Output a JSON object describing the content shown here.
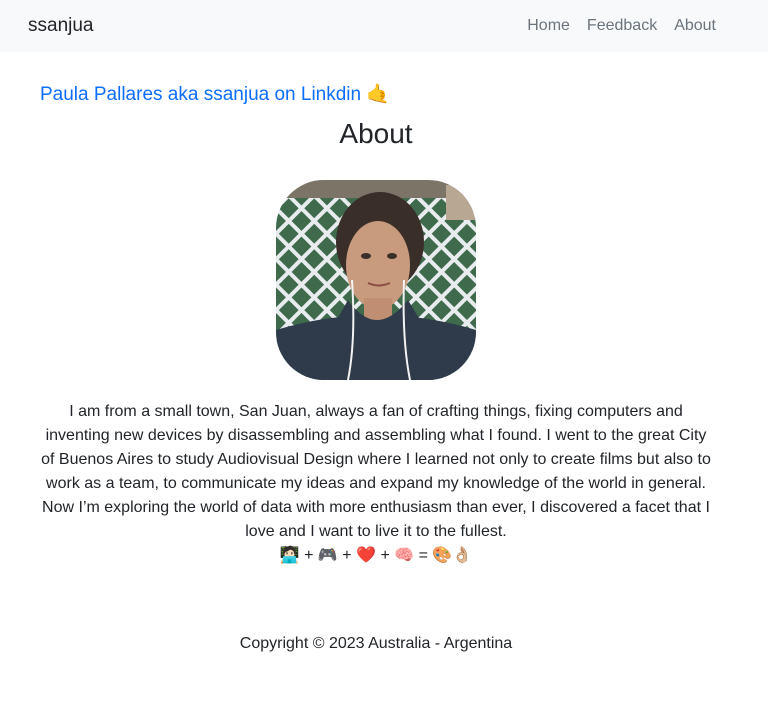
{
  "nav": {
    "brand": "ssanjua",
    "links": [
      "Home",
      "Feedback",
      "About"
    ]
  },
  "linkedin": {
    "text": "Paula Pallares aka ssanjua on Linkdin 🤙"
  },
  "page": {
    "title": "About"
  },
  "bio": {
    "text": "I am from a small town, San Juan, always a fan of crafting things, fixing computers and inventing new devices by disassembling and assembling what I found. I went to the great City of Buenos Aires to study Audiovisual Design where I learned not only to create films but also to work as a team, to communicate my ideas and expand my knowledge of the world in general. Now I’m exploring the world of data with more enthusiasm than ever, I discovered a facet that I love and I want to live it to the fullest.",
    "equation": {
      "items": [
        "🧑🏻‍💻",
        "🎮",
        "❤️",
        "🧠",
        "🎨👌🏼"
      ],
      "plus": "+",
      "equals": "="
    }
  },
  "footer": {
    "text": "Copyright © 2023 Australia - Argentina"
  },
  "colors": {
    "navbar_bg": "#f8f9fa",
    "link": "#0d6efd",
    "nav_link": "#6c757d",
    "text": "#212529"
  }
}
